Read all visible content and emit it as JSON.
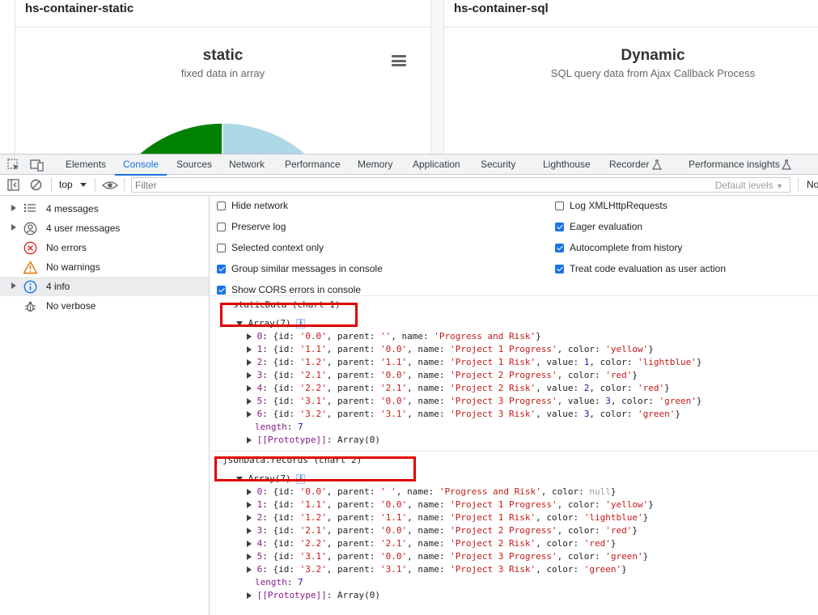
{
  "page": {
    "panels": [
      {
        "title": "hs-container-static",
        "chart_title": "static",
        "chart_subtitle": "fixed data in array"
      },
      {
        "title": "hs-container-sql",
        "chart_title": "Dynamic",
        "chart_subtitle": "SQL query data from Ajax Callback Process"
      }
    ],
    "colors": {
      "pie_green": "#008000",
      "pie_lightblue": "#add8e6"
    }
  },
  "devtools": {
    "tabs": [
      "Elements",
      "Console",
      "Sources",
      "Network",
      "Performance",
      "Memory",
      "Application",
      "Security",
      "Lighthouse",
      "Recorder",
      "Performance insights"
    ],
    "active_tab": "Console",
    "toolbar": {
      "context": "top",
      "filter_placeholder": "Filter",
      "default_levels": "Default levels",
      "cut_text": "No"
    },
    "sidebar": [
      {
        "label": "4 messages",
        "icon": "list-icon",
        "expandable": true
      },
      {
        "label": "4 user messages",
        "icon": "user-icon",
        "expandable": true
      },
      {
        "label": "No errors",
        "icon": "error-icon",
        "expandable": false
      },
      {
        "label": "No warnings",
        "icon": "warning-icon",
        "expandable": false
      },
      {
        "label": "4 info",
        "icon": "info-icon",
        "expandable": true,
        "selected": true
      },
      {
        "label": "No verbose",
        "icon": "bug-icon",
        "expandable": false
      }
    ],
    "settings_left": [
      {
        "label": "Hide network",
        "checked": false
      },
      {
        "label": "Preserve log",
        "checked": false
      },
      {
        "label": "Selected context only",
        "checked": false
      },
      {
        "label": "Group similar messages in console",
        "checked": true
      },
      {
        "label": "Show CORS errors in console",
        "checked": true
      }
    ],
    "settings_right": [
      {
        "label": "Log XMLHttpRequests",
        "checked": false
      },
      {
        "label": "Eager evaluation",
        "checked": true
      },
      {
        "label": "Autocomplete from history",
        "checked": true
      },
      {
        "label": "Treat code evaluation as user action",
        "checked": true
      }
    ],
    "logs": [
      {
        "message": "staticData (chart 1)",
        "array_header": "Array(7)",
        "items": [
          {
            "index": "0",
            "fields": [
              [
                "id",
                "'0.0'",
                "s"
              ],
              [
                "parent",
                "''",
                "s"
              ],
              [
                "name",
                "'Progress and Risk'",
                "s"
              ]
            ]
          },
          {
            "index": "1",
            "fields": [
              [
                "id",
                "'1.1'",
                "s"
              ],
              [
                "parent",
                "'0.0'",
                "s"
              ],
              [
                "name",
                "'Project 1 Progress'",
                "s"
              ],
              [
                "color",
                "'yellow'",
                "s"
              ]
            ]
          },
          {
            "index": "2",
            "fields": [
              [
                "id",
                "'1.2'",
                "s"
              ],
              [
                "parent",
                "'1.1'",
                "s"
              ],
              [
                "name",
                "'Project 1 Risk'",
                "s"
              ],
              [
                "value",
                "1",
                "n"
              ],
              [
                "color",
                "'lightblue'",
                "s"
              ]
            ]
          },
          {
            "index": "3",
            "fields": [
              [
                "id",
                "'2.1'",
                "s"
              ],
              [
                "parent",
                "'0.0'",
                "s"
              ],
              [
                "name",
                "'Project 2 Progress'",
                "s"
              ],
              [
                "color",
                "'red'",
                "s"
              ]
            ]
          },
          {
            "index": "4",
            "fields": [
              [
                "id",
                "'2.2'",
                "s"
              ],
              [
                "parent",
                "'2.1'",
                "s"
              ],
              [
                "name",
                "'Project 2 Risk'",
                "s"
              ],
              [
                "value",
                "2",
                "n"
              ],
              [
                "color",
                "'red'",
                "s"
              ]
            ]
          },
          {
            "index": "5",
            "fields": [
              [
                "id",
                "'3.1'",
                "s"
              ],
              [
                "parent",
                "'0.0'",
                "s"
              ],
              [
                "name",
                "'Project 3 Progress'",
                "s"
              ],
              [
                "value",
                "3",
                "n"
              ],
              [
                "color",
                "'green'",
                "s"
              ]
            ]
          },
          {
            "index": "6",
            "fields": [
              [
                "id",
                "'3.2'",
                "s"
              ],
              [
                "parent",
                "'3.1'",
                "s"
              ],
              [
                "name",
                "'Project 3 Risk'",
                "s"
              ],
              [
                "value",
                "3",
                "n"
              ],
              [
                "color",
                "'green'",
                "s"
              ]
            ]
          }
        ],
        "length_label": "length",
        "length_value": "7",
        "prototype_label": "[[Prototype]]",
        "prototype_value": "Array(0)"
      },
      {
        "message": "jsonData.records (chart 2)",
        "array_header": "Array(7)",
        "items": [
          {
            "index": "0",
            "fields": [
              [
                "id",
                "'0.0'",
                "s"
              ],
              [
                "parent",
                "' '",
                "s"
              ],
              [
                "name",
                "'Progress and Risk'",
                "s"
              ],
              [
                "color",
                "null",
                "nl"
              ]
            ]
          },
          {
            "index": "1",
            "fields": [
              [
                "id",
                "'1.1'",
                "s"
              ],
              [
                "parent",
                "'0.0'",
                "s"
              ],
              [
                "name",
                "'Project 1 Progress'",
                "s"
              ],
              [
                "color",
                "'yellow'",
                "s"
              ]
            ]
          },
          {
            "index": "2",
            "fields": [
              [
                "id",
                "'1.2'",
                "s"
              ],
              [
                "parent",
                "'1.1'",
                "s"
              ],
              [
                "name",
                "'Project 1 Risk'",
                "s"
              ],
              [
                "color",
                "'lightblue'",
                "s"
              ]
            ]
          },
          {
            "index": "3",
            "fields": [
              [
                "id",
                "'2.1'",
                "s"
              ],
              [
                "parent",
                "'0.0'",
                "s"
              ],
              [
                "name",
                "'Project 2 Progress'",
                "s"
              ],
              [
                "color",
                "'red'",
                "s"
              ]
            ]
          },
          {
            "index": "4",
            "fields": [
              [
                "id",
                "'2.2'",
                "s"
              ],
              [
                "parent",
                "'2.1'",
                "s"
              ],
              [
                "name",
                "'Project 2 Risk'",
                "s"
              ],
              [
                "color",
                "'red'",
                "s"
              ]
            ]
          },
          {
            "index": "5",
            "fields": [
              [
                "id",
                "'3.1'",
                "s"
              ],
              [
                "parent",
                "'0.0'",
                "s"
              ],
              [
                "name",
                "'Project 3 Progress'",
                "s"
              ],
              [
                "color",
                "'green'",
                "s"
              ]
            ]
          },
          {
            "index": "6",
            "fields": [
              [
                "id",
                "'3.2'",
                "s"
              ],
              [
                "parent",
                "'3.1'",
                "s"
              ],
              [
                "name",
                "'Project 3 Risk'",
                "s"
              ],
              [
                "color",
                "'green'",
                "s"
              ]
            ]
          }
        ],
        "length_label": "length",
        "length_value": "7",
        "prototype_label": "[[Prototype]]",
        "prototype_value": "Array(0)"
      }
    ]
  }
}
